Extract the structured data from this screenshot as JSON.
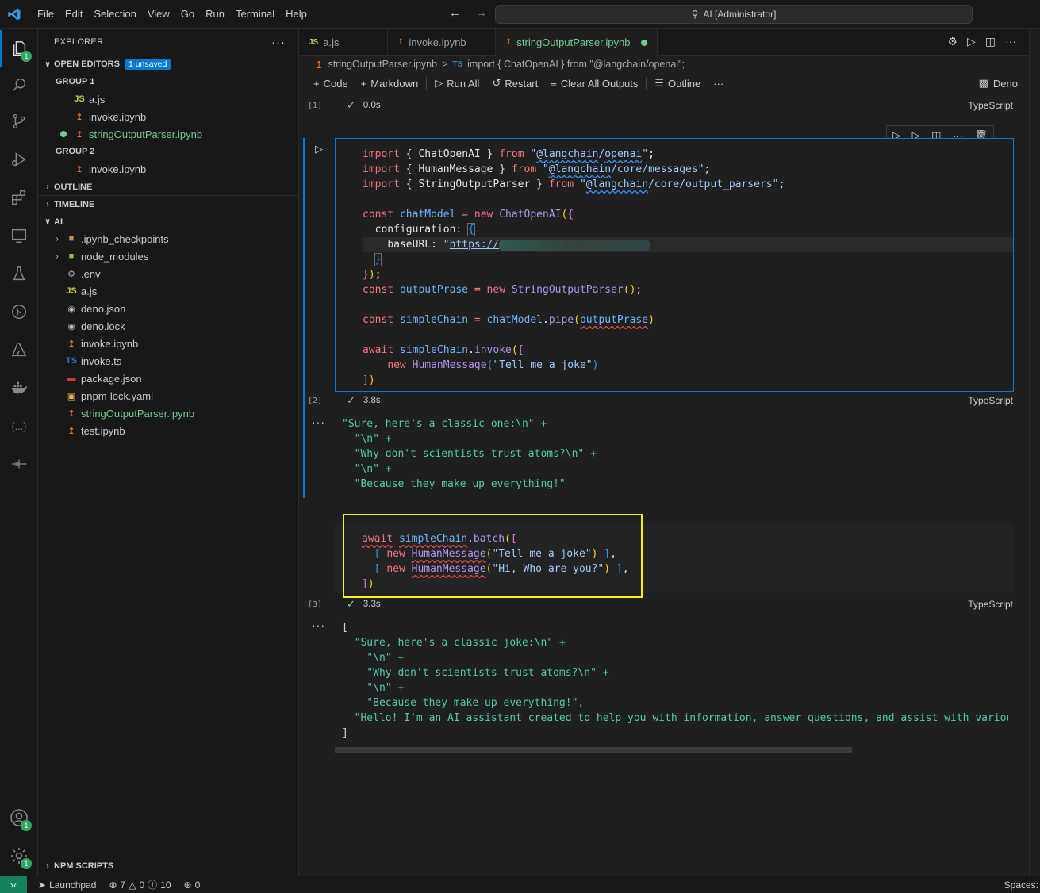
{
  "menu": [
    "File",
    "Edit",
    "Selection",
    "View",
    "Go",
    "Run",
    "Terminal",
    "Help"
  ],
  "command_center": "AI [Administrator]",
  "explorer": {
    "title": "EXPLORER",
    "open_editors": "OPEN EDITORS",
    "unsaved_badge": "1 unsaved",
    "group1": "GROUP 1",
    "group1_items": [
      "a.js",
      "invoke.ipynb",
      "stringOutputParser.ipynb"
    ],
    "group2": "GROUP 2",
    "group2_items": [
      "invoke.ipynb"
    ],
    "outline": "OUTLINE",
    "timeline": "TIMELINE",
    "workspace": "AI",
    "files": [
      {
        "name": ".ipynb_checkpoints",
        "icon": "folder-icon"
      },
      {
        "name": "node_modules",
        "icon": "folder-icon"
      },
      {
        "name": ".env",
        "icon": "gear-icon"
      },
      {
        "name": "a.js",
        "icon": "js-icon"
      },
      {
        "name": "deno.json",
        "icon": "deno-icon"
      },
      {
        "name": "deno.lock",
        "icon": "deno-icon"
      },
      {
        "name": "invoke.ipynb",
        "icon": "notebook-icon"
      },
      {
        "name": "invoke.ts",
        "icon": "ts-icon"
      },
      {
        "name": "package.json",
        "icon": "npm-icon"
      },
      {
        "name": "pnpm-lock.yaml",
        "icon": "pnpm-icon"
      },
      {
        "name": "stringOutputParser.ipynb",
        "icon": "notebook-icon"
      },
      {
        "name": "test.ipynb",
        "icon": "notebook-icon"
      }
    ],
    "npm_scripts": "NPM SCRIPTS"
  },
  "tabs": [
    {
      "label": "a.js",
      "icon": "JS"
    },
    {
      "label": "invoke.ipynb",
      "icon": "notebook"
    },
    {
      "label": "stringOutputParser.ipynb",
      "icon": "notebook"
    }
  ],
  "breadcrumb": {
    "file": "stringOutputParser.ipynb",
    "sep": ">",
    "lang": "TS",
    "symbol": "import { ChatOpenAI } from \"@langchain/openai\";"
  },
  "toolbar": {
    "code": "Code",
    "markdown": "Markdown",
    "run_all": "Run All",
    "restart": "Restart",
    "clear": "Clear All Outputs",
    "outline": "Outline",
    "kernel": "Deno"
  },
  "cells": {
    "cell1_num": "[1]",
    "cell1_time": "0.0s",
    "cell2_num": "[2]",
    "cell2_time": "3.8s",
    "cell3_num": "[3]",
    "cell3_time": "3.3s",
    "lang": "TypeScript"
  },
  "output1": [
    "\"Sure, here's a classic one:\\n\" +",
    "  \"\\n\" +",
    "  \"Why don't scientists trust atoms?\\n\" +",
    "  \"\\n\" +",
    "  \"Because they make up everything!\""
  ],
  "output2": [
    "[",
    "  \"Sure, here's a classic joke:\\n\" +",
    "    \"\\n\" +",
    "    \"Why don't scientists trust atoms?\\n\" +",
    "    \"\\n\" +",
    "    \"Because they make up everything!\",",
    "  \"Hello! I'm an AI assistant created to help you with information, answer questions, and assist with various t",
    "]"
  ],
  "status": {
    "launchpad": "Launchpad",
    "errors": "7",
    "warnings": "0",
    "info": "10",
    "ports": "0",
    "spaces": "Spaces:"
  },
  "colors": {
    "accent": "#0078d4",
    "modified": "#73c991",
    "highlight": "#f8f000",
    "remote": "#16825d"
  }
}
